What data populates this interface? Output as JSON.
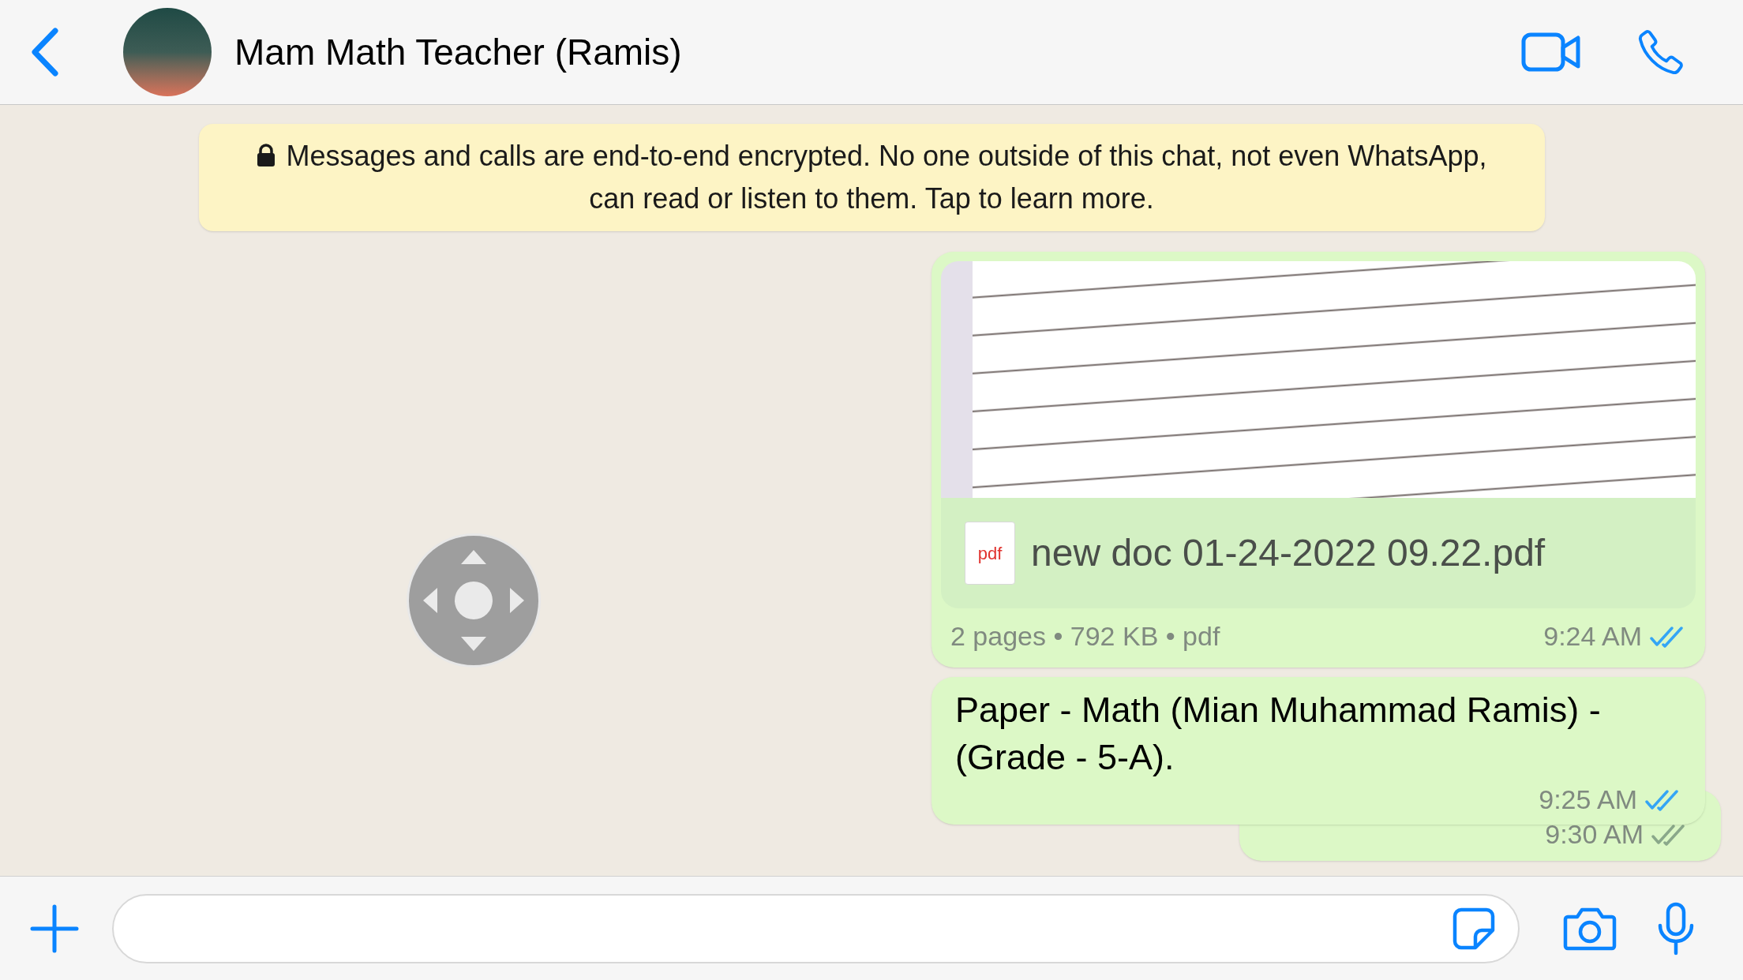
{
  "header": {
    "title": "Mam Math Teacher (Ramis)"
  },
  "encryption_notice": "Messages and calls are end-to-end encrypted. No one outside of this chat, not even WhatsApp, can read or listen to them. Tap to learn more.",
  "messages": [
    {
      "kind": "document",
      "file_icon_label": "pdf",
      "file_name": "new doc 01-24-2022 09.22.pdf",
      "details": "2 pages • 792 KB • pdf",
      "time": "9:24 AM",
      "read": true
    },
    {
      "kind": "text",
      "text": "Paper - Math (Mian Muhammad Ramis) - (Grade - 5-A).",
      "time": "9:25 AM",
      "read": true
    },
    {
      "kind": "hidden",
      "time": "9:30 AM",
      "read": false
    }
  ]
}
